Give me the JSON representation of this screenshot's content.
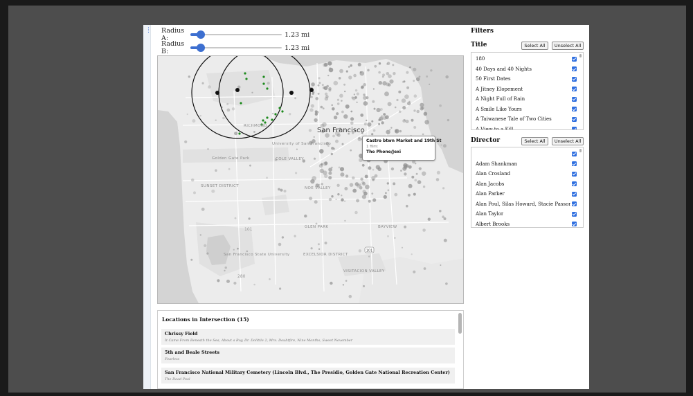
{
  "gutter_icon": "vertical-dots-icon",
  "sliders": [
    {
      "label": "Radius A:",
      "value_text": "1.23 mi",
      "fraction": 0.07
    },
    {
      "label": "Radius B:",
      "value_text": "1.23 mi",
      "fraction": 0.07
    }
  ],
  "map": {
    "city_label": "San Francisco",
    "area_labels": [
      "University of San Francisco",
      "Golden Gate Park",
      "COLE VALLEY",
      "SUNSET DISTRICT",
      "NOE VALLEY",
      "GLEN PARK",
      "BAYVIEW",
      "EXCELSIOR DISTRICT",
      "San Francisco State University",
      "VISITACION VALLEY",
      "RICHMOND",
      "DOGPATCH"
    ],
    "highway_shield": "101",
    "colors": {
      "land": "#ececec",
      "water": "#d4d4d4",
      "park": "#e2e2e2",
      "dot": "#8f8f8f",
      "selected_dot": "#1d8a1d",
      "circle": "#111111"
    },
    "tooltip": {
      "location": "Castro btwn Market and 19th St",
      "count": "1 film:",
      "film": "The Phone/Jexi"
    }
  },
  "locations": {
    "title": "Locations in Intersection (15)",
    "items": [
      {
        "name": "Chrissy Field",
        "films": "It Came From Beneath the Sea, About a Boy, Dr. Dolittle 2, Mrs. Doubtfire, Nine Months, Sweet November"
      },
      {
        "name": "5th and Beale Streets",
        "films": "Fearless"
      },
      {
        "name": "San Francisco National Military Cemetery (Lincoln Blvd., The Presidio, Golden Gate National Recreation Center)",
        "films": "The Dead Pool"
      }
    ]
  },
  "filters": {
    "title": "Filters",
    "select_all": "Select All",
    "unselect_all": "Unselect All",
    "title_section": {
      "label": "Title",
      "items": [
        "180",
        "40 Days and 40 Nights",
        "50 First Dates",
        "A Jitney Elopement",
        "A Night Full of Rain",
        "A Smile Like Yours",
        "A Taiwanese Tale of Two Cities",
        "A View to a Kill"
      ]
    },
    "director_section": {
      "label": "Director",
      "items": [
        "",
        "Adam Shankman",
        "Alan Crosland",
        "Alan Jacobs",
        "Alan Parker",
        "Alan Poul, Silas Howard, Stacie Passon",
        "Alan Taylor",
        "Albert Brooks"
      ]
    }
  }
}
